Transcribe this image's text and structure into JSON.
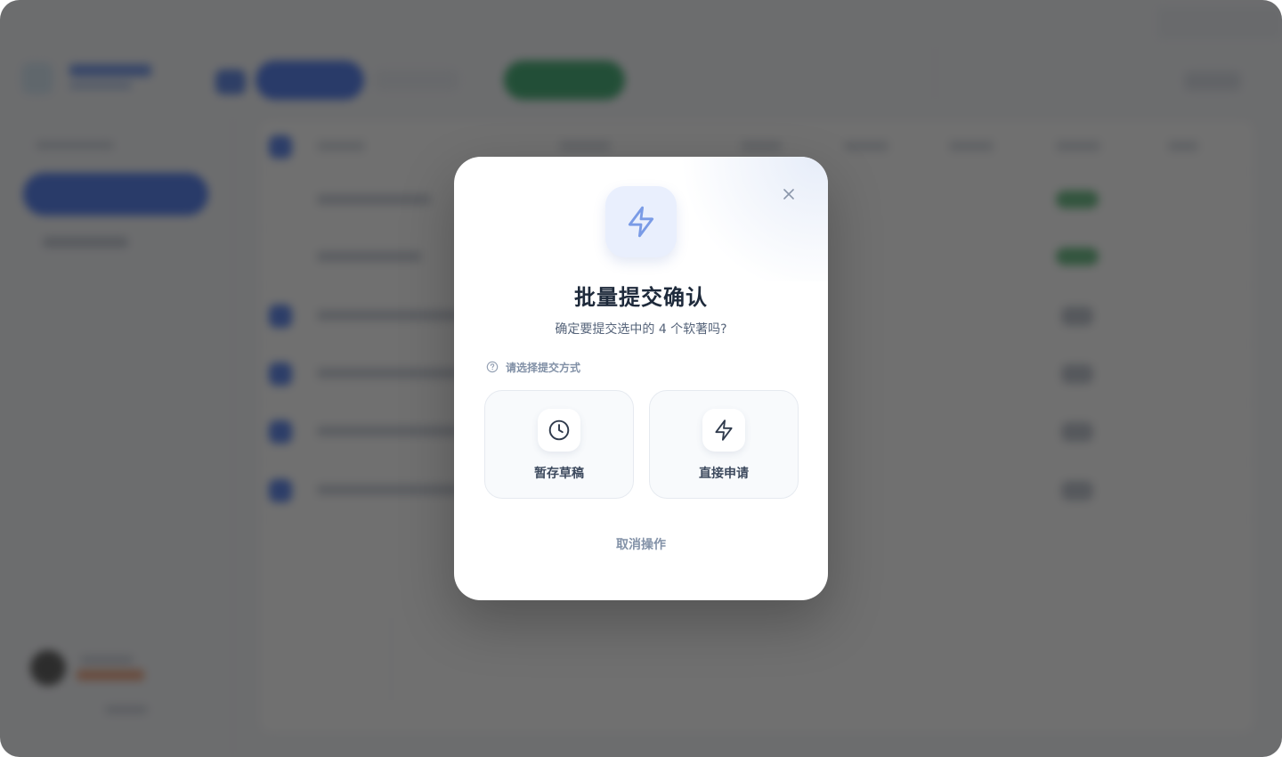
{
  "dialog": {
    "title": "批量提交确认",
    "subtitle": "确定要提交选中的 4 个软著吗?",
    "section_label": "请选择提交方式",
    "options": [
      {
        "label": "暂存草稿",
        "icon": "clock-icon"
      },
      {
        "label": "直接申请",
        "icon": "lightning-icon"
      }
    ],
    "cancel_label": "取消操作",
    "hero_icon": "lightning-icon",
    "close_icon": "close-icon",
    "help_icon": "question-circle-icon"
  },
  "colors": {
    "accent_blue": "#2f63ea",
    "accent_green": "#1d9d59",
    "hero_icon_bg": "#e9effd",
    "hero_icon_stroke": "#7a9be6",
    "title": "#1e2a3b",
    "muted": "#8190a6"
  }
}
